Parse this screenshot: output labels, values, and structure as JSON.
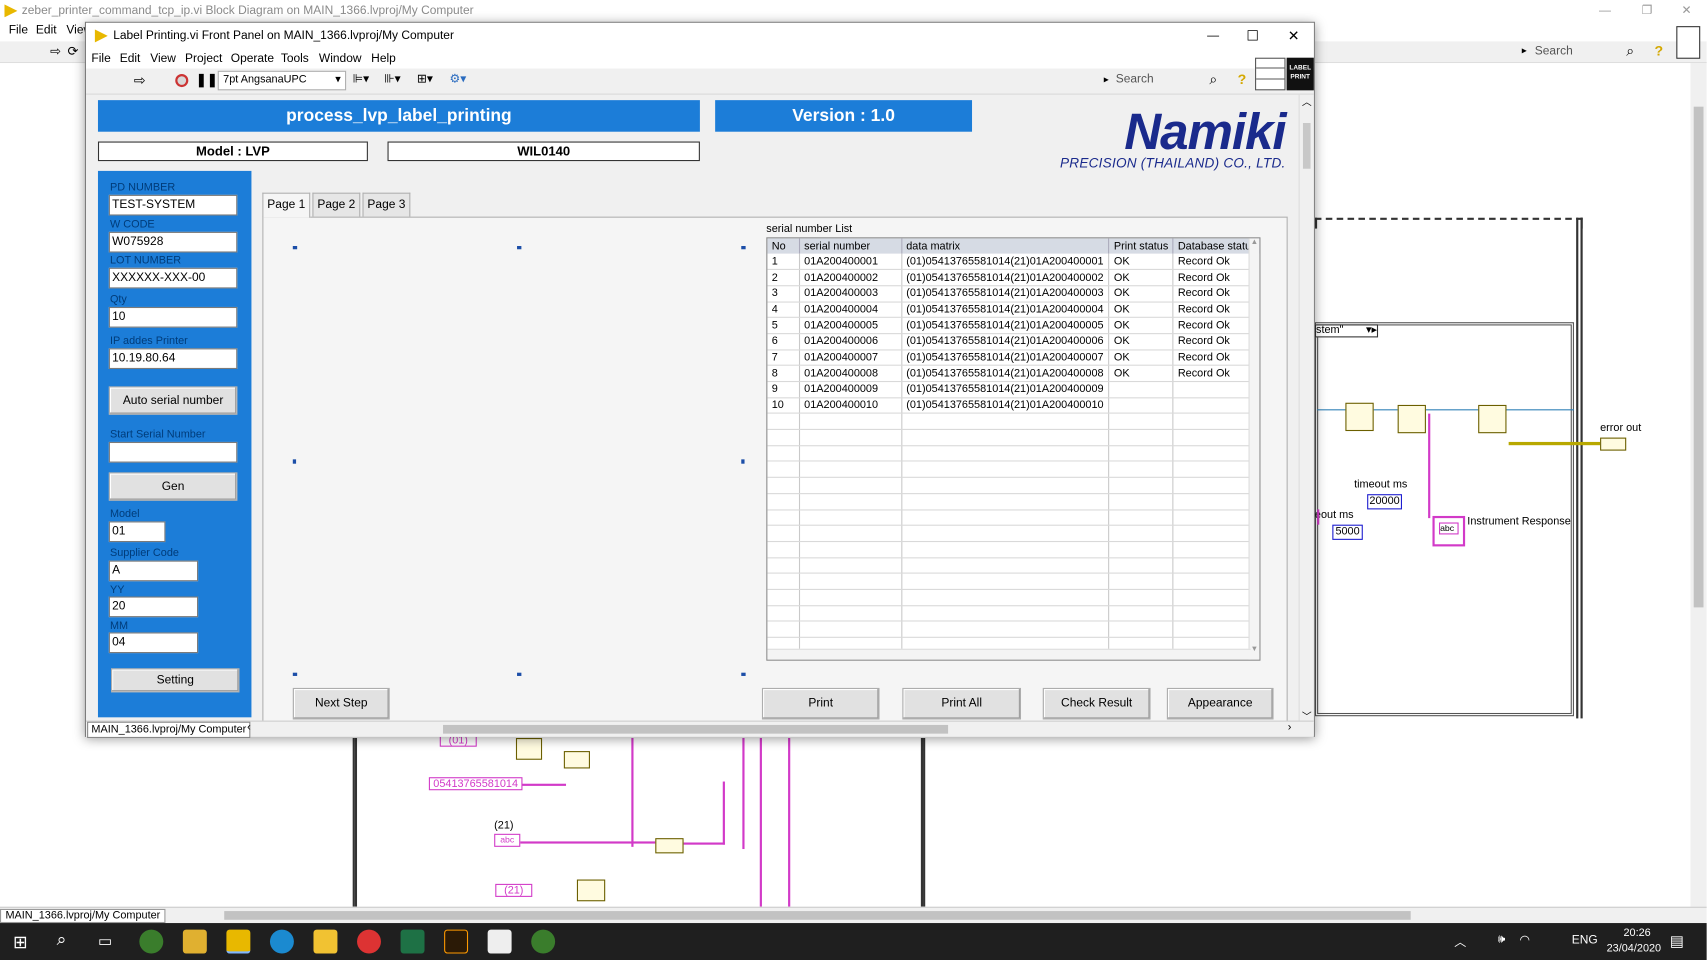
{
  "bg_window": {
    "title": "zeber_printer_command_tcp_ip.vi Block Diagram on MAIN_1366.lvproj/My Computer",
    "menu": [
      "File",
      "Edit",
      "View"
    ],
    "search_placeholder": "Search",
    "status_path": "MAIN_1366.lvproj/My Computer",
    "diagram": {
      "error_out": "error out",
      "timeout_ms": "timeout ms",
      "timeout_ms_partial": "eout ms",
      "timeout_value_1": "20000",
      "timeout_value_2": "5000",
      "instrument_response": "Instrument Response",
      "string_01": "(01)",
      "string_gtin": "05413765581014",
      "string_21": "(21)",
      "string_21_const": "(21)",
      "system_label": "stem\"",
      "abc_label": "abc"
    }
  },
  "front_panel": {
    "title": "Label Printing.vi Front Panel on MAIN_1366.lvproj/My Computer",
    "menu": [
      "File",
      "Edit",
      "View",
      "Project",
      "Operate",
      "Tools",
      "Window",
      "Help"
    ],
    "font_selector": "7pt AngsanaUPC",
    "search_placeholder": "Search",
    "label_icon_text": "LABEL PRINT",
    "status_path": "MAIN_1366.lvproj/My Computer",
    "header": {
      "title": "process_lvp_label_printing",
      "version": "Version : 1.0",
      "model": "Model : LVP",
      "work_instruction": "WIL0140",
      "brand_main": "Namiki",
      "brand_sub": "PRECISION (THAILAND) CO., LTD."
    },
    "sidebar": {
      "pd_number_label": "PD NUMBER",
      "pd_number_value": "TEST-SYSTEM",
      "w_code_label": "W CODE",
      "w_code_value": "W075928",
      "lot_number_label": "LOT NUMBER",
      "lot_number_value": "XXXXXX-XXX-00",
      "qty_label": "Qty",
      "qty_value": "10",
      "ip_label": "IP addes Printer",
      "ip_value": "10.19.80.64",
      "auto_serial_button": "Auto serial number",
      "start_serial_label": "Start Serial Number",
      "start_serial_value": "",
      "gen_button": "Gen",
      "model_label": "Model",
      "model_value": "01",
      "supplier_label": "Supplier Code",
      "supplier_value": "A",
      "yy_label": "YY",
      "yy_value": "20",
      "mm_label": "MM",
      "mm_value": "04",
      "setting_button": "Setting"
    },
    "tabs": [
      "Page 1",
      "Page 2",
      "Page 3"
    ],
    "serial_list": {
      "caption": "serial number List",
      "columns": [
        "No",
        "serial number",
        "data matrix",
        "Print status",
        "Database status"
      ],
      "rows": [
        [
          "1",
          "01A200400001",
          "(01)05413765581014(21)01A200400001",
          "OK",
          "Record Ok"
        ],
        [
          "2",
          "01A200400002",
          "(01)05413765581014(21)01A200400002",
          "OK",
          "Record Ok"
        ],
        [
          "3",
          "01A200400003",
          "(01)05413765581014(21)01A200400003",
          "OK",
          "Record Ok"
        ],
        [
          "4",
          "01A200400004",
          "(01)05413765581014(21)01A200400004",
          "OK",
          "Record Ok"
        ],
        [
          "5",
          "01A200400005",
          "(01)05413765581014(21)01A200400005",
          "OK",
          "Record Ok"
        ],
        [
          "6",
          "01A200400006",
          "(01)05413765581014(21)01A200400006",
          "OK",
          "Record Ok"
        ],
        [
          "7",
          "01A200400007",
          "(01)05413765581014(21)01A200400007",
          "OK",
          "Record Ok"
        ],
        [
          "8",
          "01A200400008",
          "(01)05413765581014(21)01A200400008",
          "OK",
          "Record Ok"
        ],
        [
          "9",
          "01A200400009",
          "(01)05413765581014(21)01A200400009",
          "",
          ""
        ],
        [
          "10",
          "01A200400010",
          "(01)05413765581014(21)01A200400010",
          "",
          ""
        ]
      ],
      "empty_rows": 15
    },
    "buttons": {
      "next_step": "Next Step",
      "print": "Print",
      "print_all": "Print All",
      "check_result": "Check Result",
      "appearance": "Appearance"
    }
  },
  "taskbar": {
    "language": "ENG",
    "time": "20:26",
    "date": "23/04/2020"
  },
  "colors": {
    "panel_blue": "#1c7dd8",
    "brand_navy": "#1a2a8c",
    "wire_pink": "#d23ac8",
    "wire_yellow": "#b8a800"
  }
}
